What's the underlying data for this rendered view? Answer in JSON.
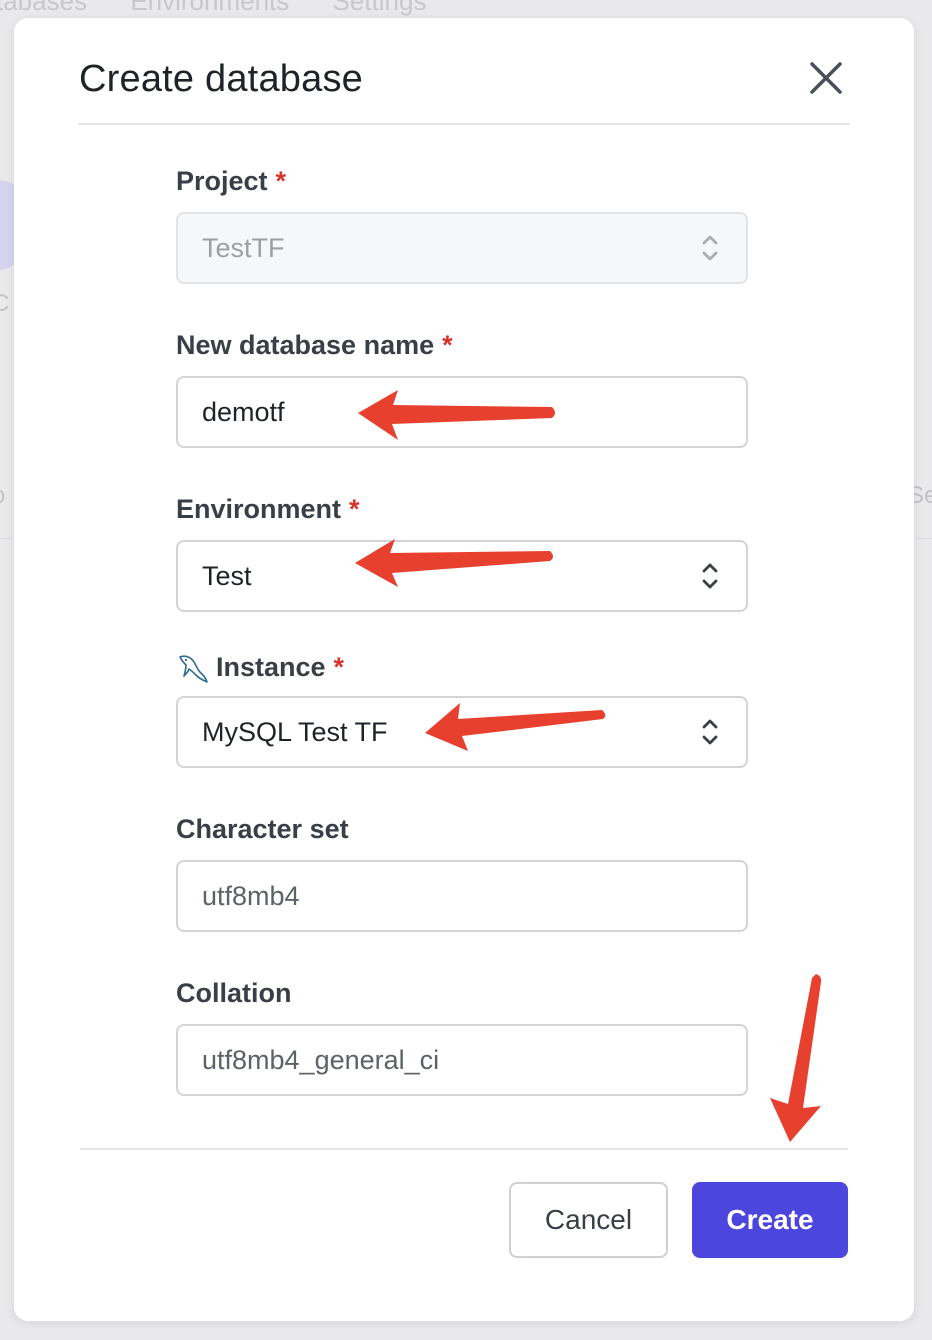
{
  "background": {
    "nav": [
      "tabases",
      "Environments",
      "Settings"
    ],
    "fragments": [
      "C",
      "o",
      "Se"
    ]
  },
  "modal": {
    "title": "Create database",
    "close_icon": "close-icon"
  },
  "fields": {
    "project": {
      "label": "Project",
      "required": "*",
      "value": "TestTF",
      "disabled": true
    },
    "database_name": {
      "label": "New database name",
      "required": "*",
      "value": "demotf"
    },
    "environment": {
      "label": "Environment",
      "required": "*",
      "value": "Test"
    },
    "instance": {
      "label": "Instance",
      "required": "*",
      "value": "MySQL Test TF",
      "icon": "mysql-dolphin-icon"
    },
    "character_set": {
      "label": "Character set",
      "placeholder": "utf8mb4"
    },
    "collation": {
      "label": "Collation",
      "placeholder": "utf8mb4_general_ci"
    }
  },
  "buttons": {
    "cancel": "Cancel",
    "create": "Create"
  },
  "colors": {
    "accent": "#4c46df",
    "required": "#d8342c",
    "annotation_arrow": "#e8402e"
  }
}
